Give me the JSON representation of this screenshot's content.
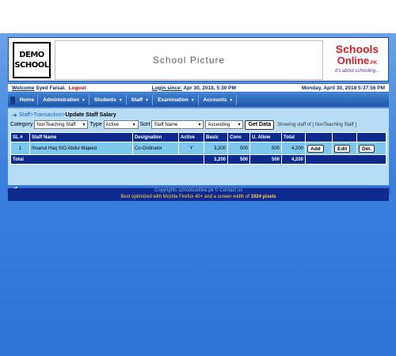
{
  "logo": {
    "line1": "DEMO",
    "line2": "SCHOOL"
  },
  "banner": {
    "picture_text": "School Picture"
  },
  "brand": {
    "line1": "Schools",
    "line2": "Online",
    "line2_suffix": ".PK",
    "tagline": "it's about schooling..."
  },
  "info": {
    "welcome_label": "Welcome",
    "user": "Syed Faisal.",
    "logout": "Logout",
    "login_label": "Login since:",
    "login_value": "Apr 30, 2018, 5:30 PM",
    "now": "Monday, April 30, 2018 5:37:56 PM"
  },
  "nav": [
    {
      "label": "Home",
      "dropdown": false
    },
    {
      "label": "Administration",
      "dropdown": true
    },
    {
      "label": "Students",
      "dropdown": true
    },
    {
      "label": "Staff",
      "dropdown": true
    },
    {
      "label": "Examination",
      "dropdown": true
    },
    {
      "label": "Accounts",
      "dropdown": true
    }
  ],
  "breadcrumb": {
    "staff": "Staff",
    "sep": " > ",
    "transaction": "Transaction",
    "current": "Update Staff Salary"
  },
  "filters": {
    "category_label": "Category",
    "category_value": "NonTeaching Staff",
    "type_label": "Type",
    "type_value": "Active",
    "sort_label": "Sort",
    "sort_value": "Staff Name",
    "order_value": "Ascending",
    "get_data": "Get Data",
    "showing": "Showing staff of [ NonTeaching Staff ]"
  },
  "table": {
    "headers": [
      "SL #",
      "Staff Name",
      "Designation",
      "Active",
      "Basic",
      "Conv",
      "U. Allow",
      "Total",
      "",
      "",
      ""
    ],
    "rows": [
      {
        "sl": "1",
        "name": "Ihsanul Haq S/O Abdul Majeed",
        "designation": "Co-Ordinator",
        "active": "Y",
        "basic": "3,200",
        "conv": "500",
        "uallow": "500",
        "total": "4,200",
        "add": "Add",
        "edit": "Edit",
        "del": "Del."
      }
    ],
    "total": {
      "label": "Total",
      "basic": "3,200",
      "conv": "500",
      "uallow": "500",
      "total": "4,200"
    }
  },
  "footer": {
    "copyright": "Copyrights schoolsonline.pk © Contact us",
    "optimized": "Best optimized with Mozilla Firefox 40+ and a screen width of",
    "width": "1024 pixels"
  }
}
